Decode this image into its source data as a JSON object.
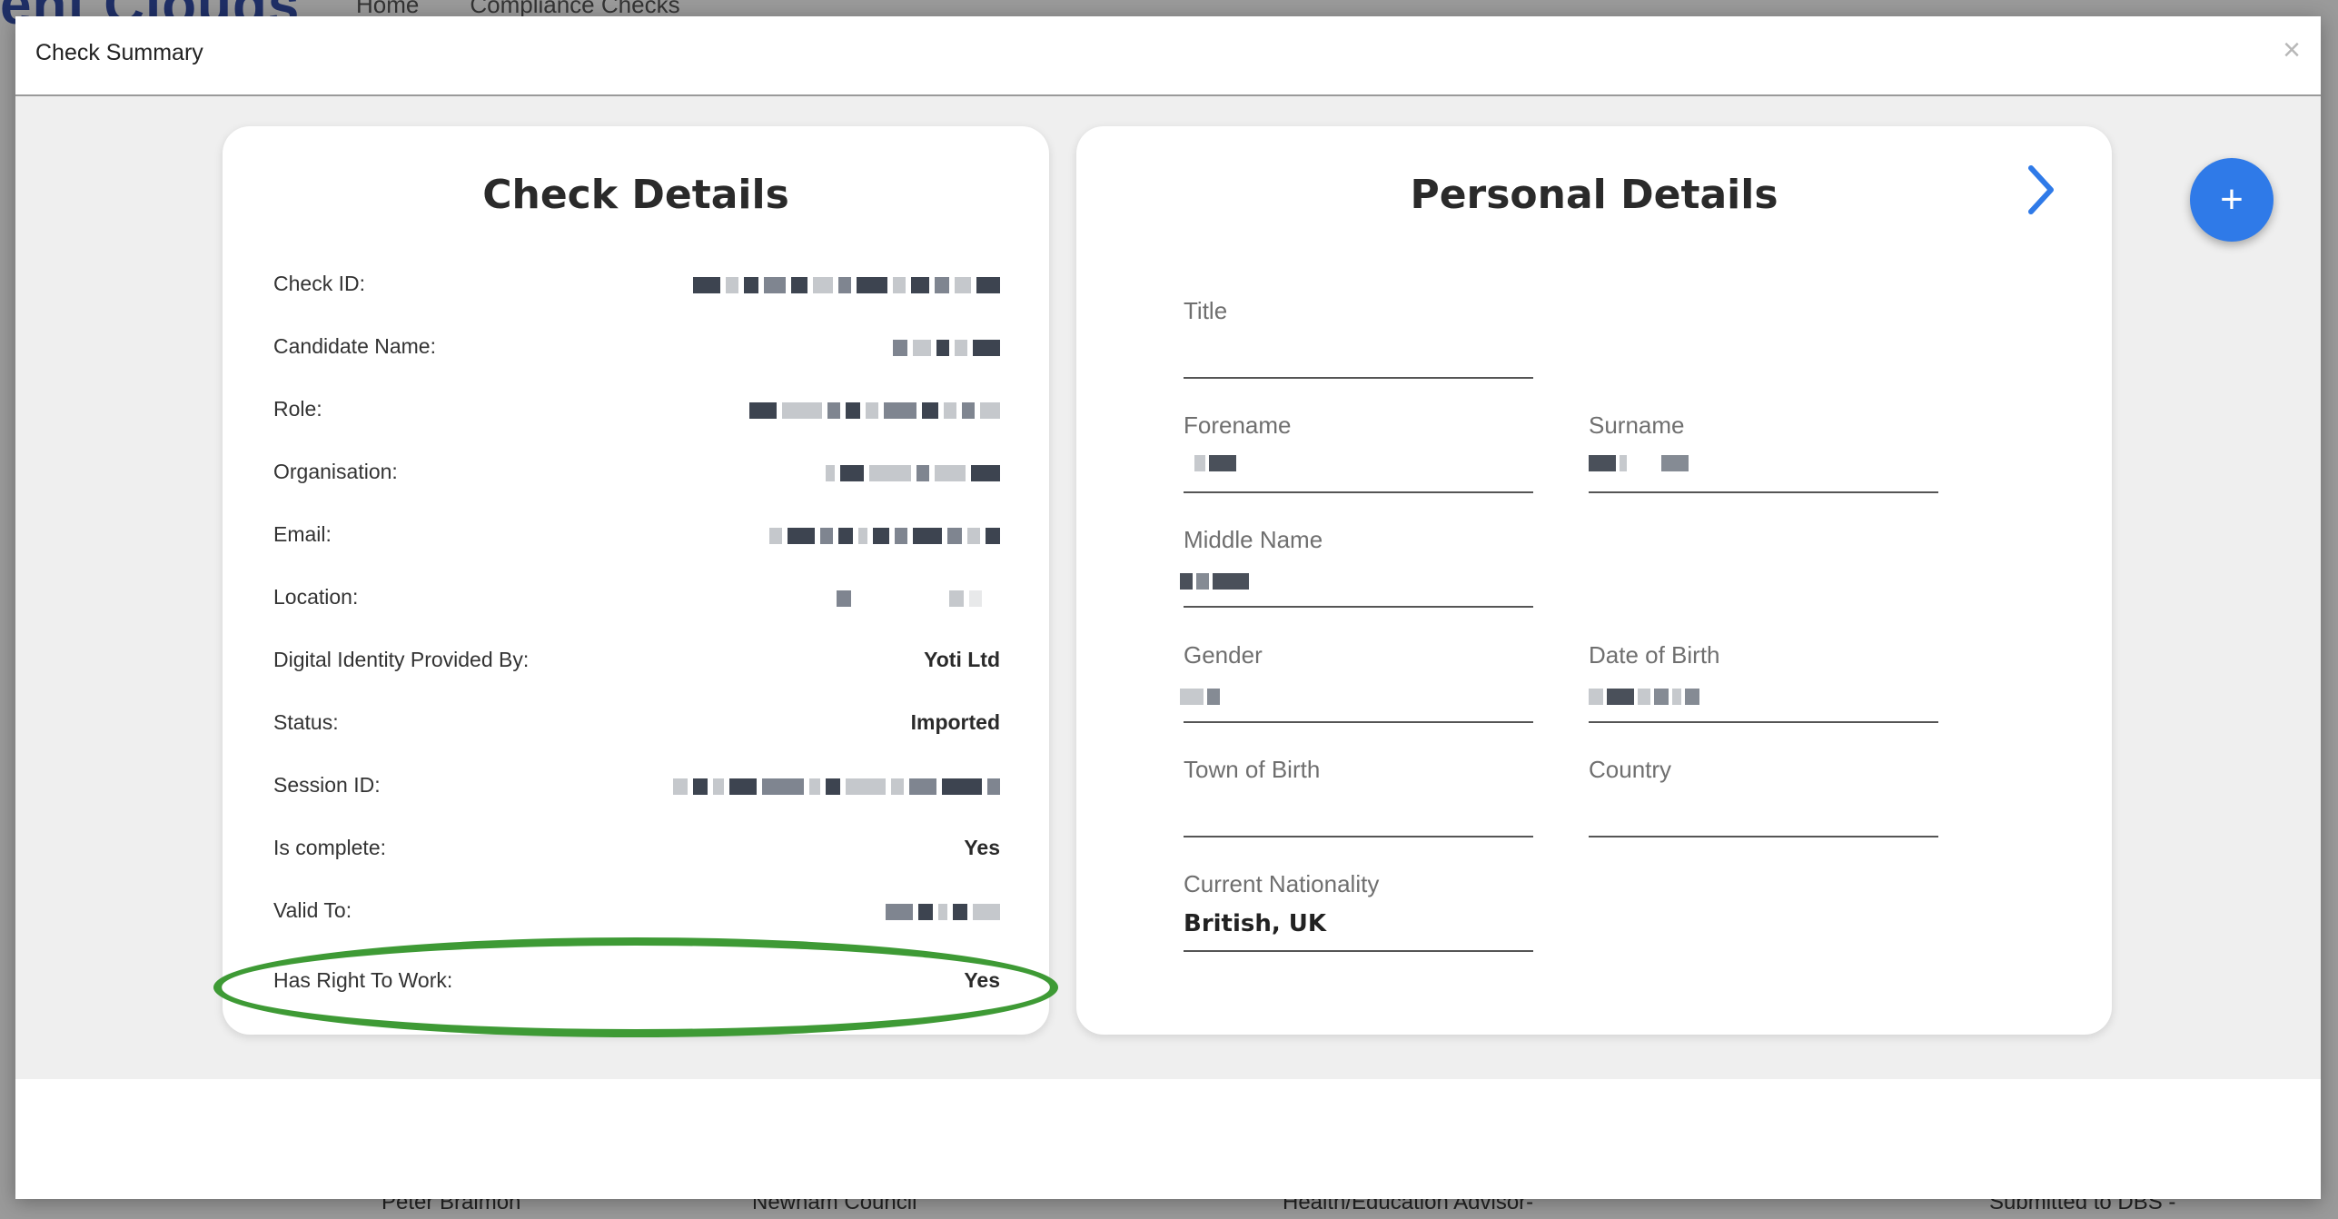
{
  "background": {
    "logo": "ent Clouds",
    "nav": [
      "Home",
      "Compliance Checks"
    ],
    "row": [
      "Peter Braimoh",
      "Newham Council",
      "Health/Education Advisor-",
      "Submitted to DBS -"
    ]
  },
  "modal": {
    "title": "Check Summary",
    "close_icon": "close-icon"
  },
  "check_details": {
    "heading": "Check Details",
    "rows": [
      {
        "label": "Check ID:",
        "value": null
      },
      {
        "label": "Candidate Name:",
        "value": null
      },
      {
        "label": "Role:",
        "value": null
      },
      {
        "label": "Organisation:",
        "value": null
      },
      {
        "label": "Email:",
        "value": null
      },
      {
        "label": "Location:",
        "value": null
      },
      {
        "label": "Digital Identity Provided By:",
        "value": "Yoti Ltd"
      },
      {
        "label": "Status:",
        "value": "Imported"
      },
      {
        "label": "Session ID:",
        "value": null
      },
      {
        "label": "Is complete:",
        "value": "Yes"
      },
      {
        "label": "Valid To:",
        "value": null
      },
      {
        "label": "Has Right To Work:",
        "value": "Yes"
      }
    ],
    "highlight_color": "#3e9a35"
  },
  "personal_details": {
    "heading": "Personal Details",
    "next_icon": "chevron-right-icon",
    "fields": {
      "title": {
        "label": "Title",
        "value": ""
      },
      "forename": {
        "label": "Forename",
        "value": null
      },
      "surname": {
        "label": "Surname",
        "value": null
      },
      "middle_name": {
        "label": "Middle Name",
        "value": null
      },
      "gender": {
        "label": "Gender",
        "value": null
      },
      "date_of_birth": {
        "label": "Date of Birth",
        "value": null
      },
      "town_of_birth": {
        "label": "Town of Birth",
        "value": ""
      },
      "country": {
        "label": "Country",
        "value": ""
      },
      "current_nationality": {
        "label": "Current Nationality",
        "value": "British, UK"
      }
    }
  },
  "fab": {
    "label": "+",
    "icon": "plus-icon",
    "color": "#2f7ae8"
  },
  "accent_color": "#2f7ae8"
}
